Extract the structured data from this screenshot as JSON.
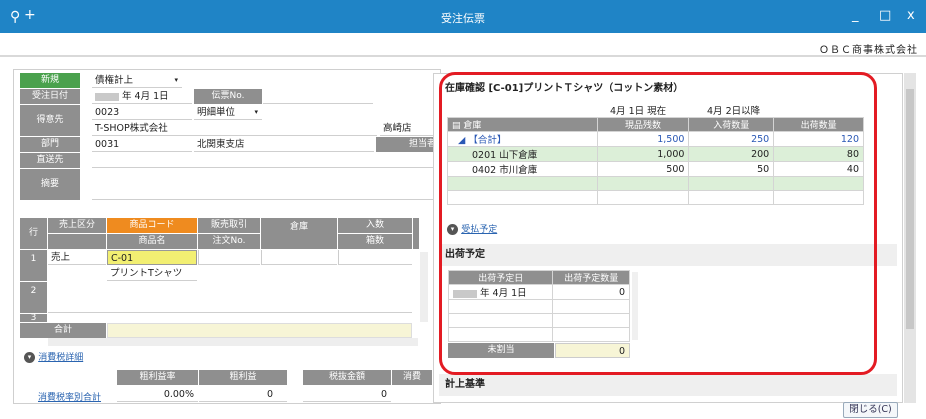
{
  "titlebar": {
    "search_icon": "search-icon",
    "plus": "+",
    "title": "受注伝票",
    "minimize": "_",
    "maximize": "□",
    "close": "x"
  },
  "company": "ＯＢＣ商事株式会社",
  "header_form": {
    "new_label": "新規",
    "mode_value": "債権計上",
    "order_date_label": "受注日付",
    "order_date_value": "年  4月  1日",
    "slip_no_label": "伝票No.",
    "customer_label": "得意先",
    "customer_code": "0023",
    "detail_unit": "明細単位",
    "customer_name": "T-SHOP株式会社",
    "store": "高崎店",
    "dept_label": "部門",
    "dept_code": "0031",
    "dept_name": "北関東支店",
    "staff_label": "担当者",
    "ship_to_label": "直送先",
    "summary_label": "摘要"
  },
  "detail_grid": {
    "row_label": "行",
    "sales_type_label": "売上区分",
    "product_code_label": "商品コード",
    "product_name_label": "商品名",
    "sales_trade_label": "販売取引",
    "order_no_label": "注文No.",
    "warehouse_label": "倉庫",
    "qty_label": "入数",
    "box_label": "箱数",
    "rows": [
      {
        "no": "1",
        "sales_type": "売上",
        "code": "C-01",
        "name": "プリントTシャツ"
      },
      {
        "no": "2",
        "sales_type": "",
        "code": "",
        "name": ""
      },
      {
        "no": "3",
        "sales_type": "",
        "code": "",
        "name": ""
      }
    ],
    "total_label": "合計"
  },
  "tax_section": {
    "tax_detail_link": "消費税詳細",
    "tax_rate_total_link": "消費税率別合計",
    "gross_margin_label": "粗利益率",
    "gross_profit_label": "粗利益",
    "excl_tax_label": "税抜金額",
    "tax_label": "消費",
    "gross_margin_value": "0.00%",
    "gross_profit_value": "0",
    "excl_tax_value": "0"
  },
  "stock_panel": {
    "title": "在庫確認  [C-01]プリントＴシャツ（コットン素材）",
    "date_now": "4月  1日  現在",
    "date_after": "4月  2日以降",
    "col_warehouse": "倉庫",
    "col_stock": "現品残数",
    "col_in": "入荷数量",
    "col_out": "出荷数量",
    "rows": [
      {
        "name": "【合計】",
        "stock": "1,500",
        "in": "250",
        "out": "120",
        "total": true
      },
      {
        "name": "0201 山下倉庫",
        "stock": "1,000",
        "in": "200",
        "out": "80",
        "total": false
      },
      {
        "name": "0402 市川倉庫",
        "stock": "500",
        "in": "50",
        "out": "40",
        "total": false
      }
    ],
    "payment_link": "受払予定"
  },
  "ship_plan": {
    "title": "出荷予定",
    "col_date": "出荷予定日",
    "col_qty": "出荷予定数量",
    "date_value": "年  4月  1日",
    "qty_value": "0",
    "unassigned_label": "未割当",
    "unassigned_value": "0"
  },
  "calc_base": {
    "title": "計上基準"
  },
  "close_button": "閉じる(C)",
  "colors": {
    "titlebar": "#1f84c6",
    "header_gray": "#8f8f8f",
    "header_green": "#4aa14d",
    "header_orange": "#ef8b1f",
    "highlight_red": "#e31b23"
  }
}
